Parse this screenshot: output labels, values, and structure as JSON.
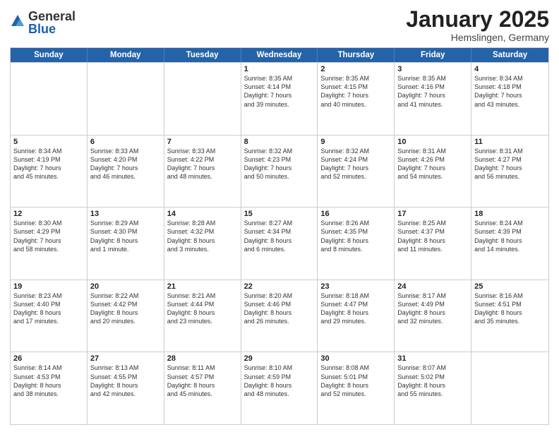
{
  "logo": {
    "general": "General",
    "blue": "Blue"
  },
  "title": {
    "month": "January 2025",
    "location": "Hemslingen, Germany"
  },
  "header": {
    "days": [
      "Sunday",
      "Monday",
      "Tuesday",
      "Wednesday",
      "Thursday",
      "Friday",
      "Saturday"
    ]
  },
  "weeks": [
    [
      {
        "day": "",
        "info": ""
      },
      {
        "day": "",
        "info": ""
      },
      {
        "day": "",
        "info": ""
      },
      {
        "day": "1",
        "info": "Sunrise: 8:35 AM\nSunset: 4:14 PM\nDaylight: 7 hours\nand 39 minutes."
      },
      {
        "day": "2",
        "info": "Sunrise: 8:35 AM\nSunset: 4:15 PM\nDaylight: 7 hours\nand 40 minutes."
      },
      {
        "day": "3",
        "info": "Sunrise: 8:35 AM\nSunset: 4:16 PM\nDaylight: 7 hours\nand 41 minutes."
      },
      {
        "day": "4",
        "info": "Sunrise: 8:34 AM\nSunset: 4:18 PM\nDaylight: 7 hours\nand 43 minutes."
      }
    ],
    [
      {
        "day": "5",
        "info": "Sunrise: 8:34 AM\nSunset: 4:19 PM\nDaylight: 7 hours\nand 45 minutes."
      },
      {
        "day": "6",
        "info": "Sunrise: 8:33 AM\nSunset: 4:20 PM\nDaylight: 7 hours\nand 46 minutes."
      },
      {
        "day": "7",
        "info": "Sunrise: 8:33 AM\nSunset: 4:22 PM\nDaylight: 7 hours\nand 48 minutes."
      },
      {
        "day": "8",
        "info": "Sunrise: 8:32 AM\nSunset: 4:23 PM\nDaylight: 7 hours\nand 50 minutes."
      },
      {
        "day": "9",
        "info": "Sunrise: 8:32 AM\nSunset: 4:24 PM\nDaylight: 7 hours\nand 52 minutes."
      },
      {
        "day": "10",
        "info": "Sunrise: 8:31 AM\nSunset: 4:26 PM\nDaylight: 7 hours\nand 54 minutes."
      },
      {
        "day": "11",
        "info": "Sunrise: 8:31 AM\nSunset: 4:27 PM\nDaylight: 7 hours\nand 56 minutes."
      }
    ],
    [
      {
        "day": "12",
        "info": "Sunrise: 8:30 AM\nSunset: 4:29 PM\nDaylight: 7 hours\nand 58 minutes."
      },
      {
        "day": "13",
        "info": "Sunrise: 8:29 AM\nSunset: 4:30 PM\nDaylight: 8 hours\nand 1 minute."
      },
      {
        "day": "14",
        "info": "Sunrise: 8:28 AM\nSunset: 4:32 PM\nDaylight: 8 hours\nand 3 minutes."
      },
      {
        "day": "15",
        "info": "Sunrise: 8:27 AM\nSunset: 4:34 PM\nDaylight: 8 hours\nand 6 minutes."
      },
      {
        "day": "16",
        "info": "Sunrise: 8:26 AM\nSunset: 4:35 PM\nDaylight: 8 hours\nand 8 minutes."
      },
      {
        "day": "17",
        "info": "Sunrise: 8:25 AM\nSunset: 4:37 PM\nDaylight: 8 hours\nand 11 minutes."
      },
      {
        "day": "18",
        "info": "Sunrise: 8:24 AM\nSunset: 4:39 PM\nDaylight: 8 hours\nand 14 minutes."
      }
    ],
    [
      {
        "day": "19",
        "info": "Sunrise: 8:23 AM\nSunset: 4:40 PM\nDaylight: 8 hours\nand 17 minutes."
      },
      {
        "day": "20",
        "info": "Sunrise: 8:22 AM\nSunset: 4:42 PM\nDaylight: 8 hours\nand 20 minutes."
      },
      {
        "day": "21",
        "info": "Sunrise: 8:21 AM\nSunset: 4:44 PM\nDaylight: 8 hours\nand 23 minutes."
      },
      {
        "day": "22",
        "info": "Sunrise: 8:20 AM\nSunset: 4:46 PM\nDaylight: 8 hours\nand 26 minutes."
      },
      {
        "day": "23",
        "info": "Sunrise: 8:18 AM\nSunset: 4:47 PM\nDaylight: 8 hours\nand 29 minutes."
      },
      {
        "day": "24",
        "info": "Sunrise: 8:17 AM\nSunset: 4:49 PM\nDaylight: 8 hours\nand 32 minutes."
      },
      {
        "day": "25",
        "info": "Sunrise: 8:16 AM\nSunset: 4:51 PM\nDaylight: 8 hours\nand 35 minutes."
      }
    ],
    [
      {
        "day": "26",
        "info": "Sunrise: 8:14 AM\nSunset: 4:53 PM\nDaylight: 8 hours\nand 38 minutes."
      },
      {
        "day": "27",
        "info": "Sunrise: 8:13 AM\nSunset: 4:55 PM\nDaylight: 8 hours\nand 42 minutes."
      },
      {
        "day": "28",
        "info": "Sunrise: 8:11 AM\nSunset: 4:57 PM\nDaylight: 8 hours\nand 45 minutes."
      },
      {
        "day": "29",
        "info": "Sunrise: 8:10 AM\nSunset: 4:59 PM\nDaylight: 8 hours\nand 48 minutes."
      },
      {
        "day": "30",
        "info": "Sunrise: 8:08 AM\nSunset: 5:01 PM\nDaylight: 8 hours\nand 52 minutes."
      },
      {
        "day": "31",
        "info": "Sunrise: 8:07 AM\nSunset: 5:02 PM\nDaylight: 8 hours\nand 55 minutes."
      },
      {
        "day": "",
        "info": ""
      }
    ]
  ]
}
